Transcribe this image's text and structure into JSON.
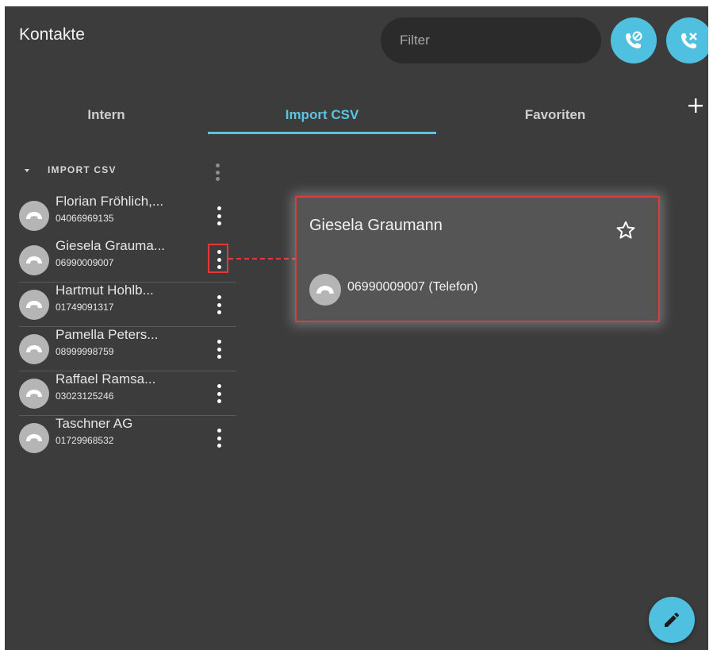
{
  "header": {
    "title": "Kontakte",
    "filter_placeholder": "Filter",
    "voicemail_button_icon": "phone-voicemail-icon",
    "missed_calls_button_icon": "phone-missed-icon",
    "accent_color": "#4fc0df"
  },
  "tabs": [
    {
      "label": "Intern",
      "active": false
    },
    {
      "label": "Import CSV",
      "active": true
    },
    {
      "label": "Favoriten",
      "active": false
    }
  ],
  "group": {
    "label": "IMPORT CSV"
  },
  "contacts": [
    {
      "name": "Florian Fröhlich,...",
      "number": "04066969135"
    },
    {
      "name": "Giesela Grauma...",
      "number": "06990009007",
      "selected": true
    },
    {
      "name": "Hartmut Hohlb...",
      "number": "01749091317"
    },
    {
      "name": "Pamella Peters...",
      "number": "08999998759"
    },
    {
      "name": "Raffael Ramsa...",
      "number": "03023125246"
    },
    {
      "name": "Taschner AG",
      "number": "01729968532"
    }
  ],
  "detail_card": {
    "name": "Giesela Graumann",
    "phone": "06990009007 (Telefon)",
    "favorite": false
  },
  "highlight_color": "#e23a3a",
  "fab": {
    "icon": "pencil-icon"
  }
}
